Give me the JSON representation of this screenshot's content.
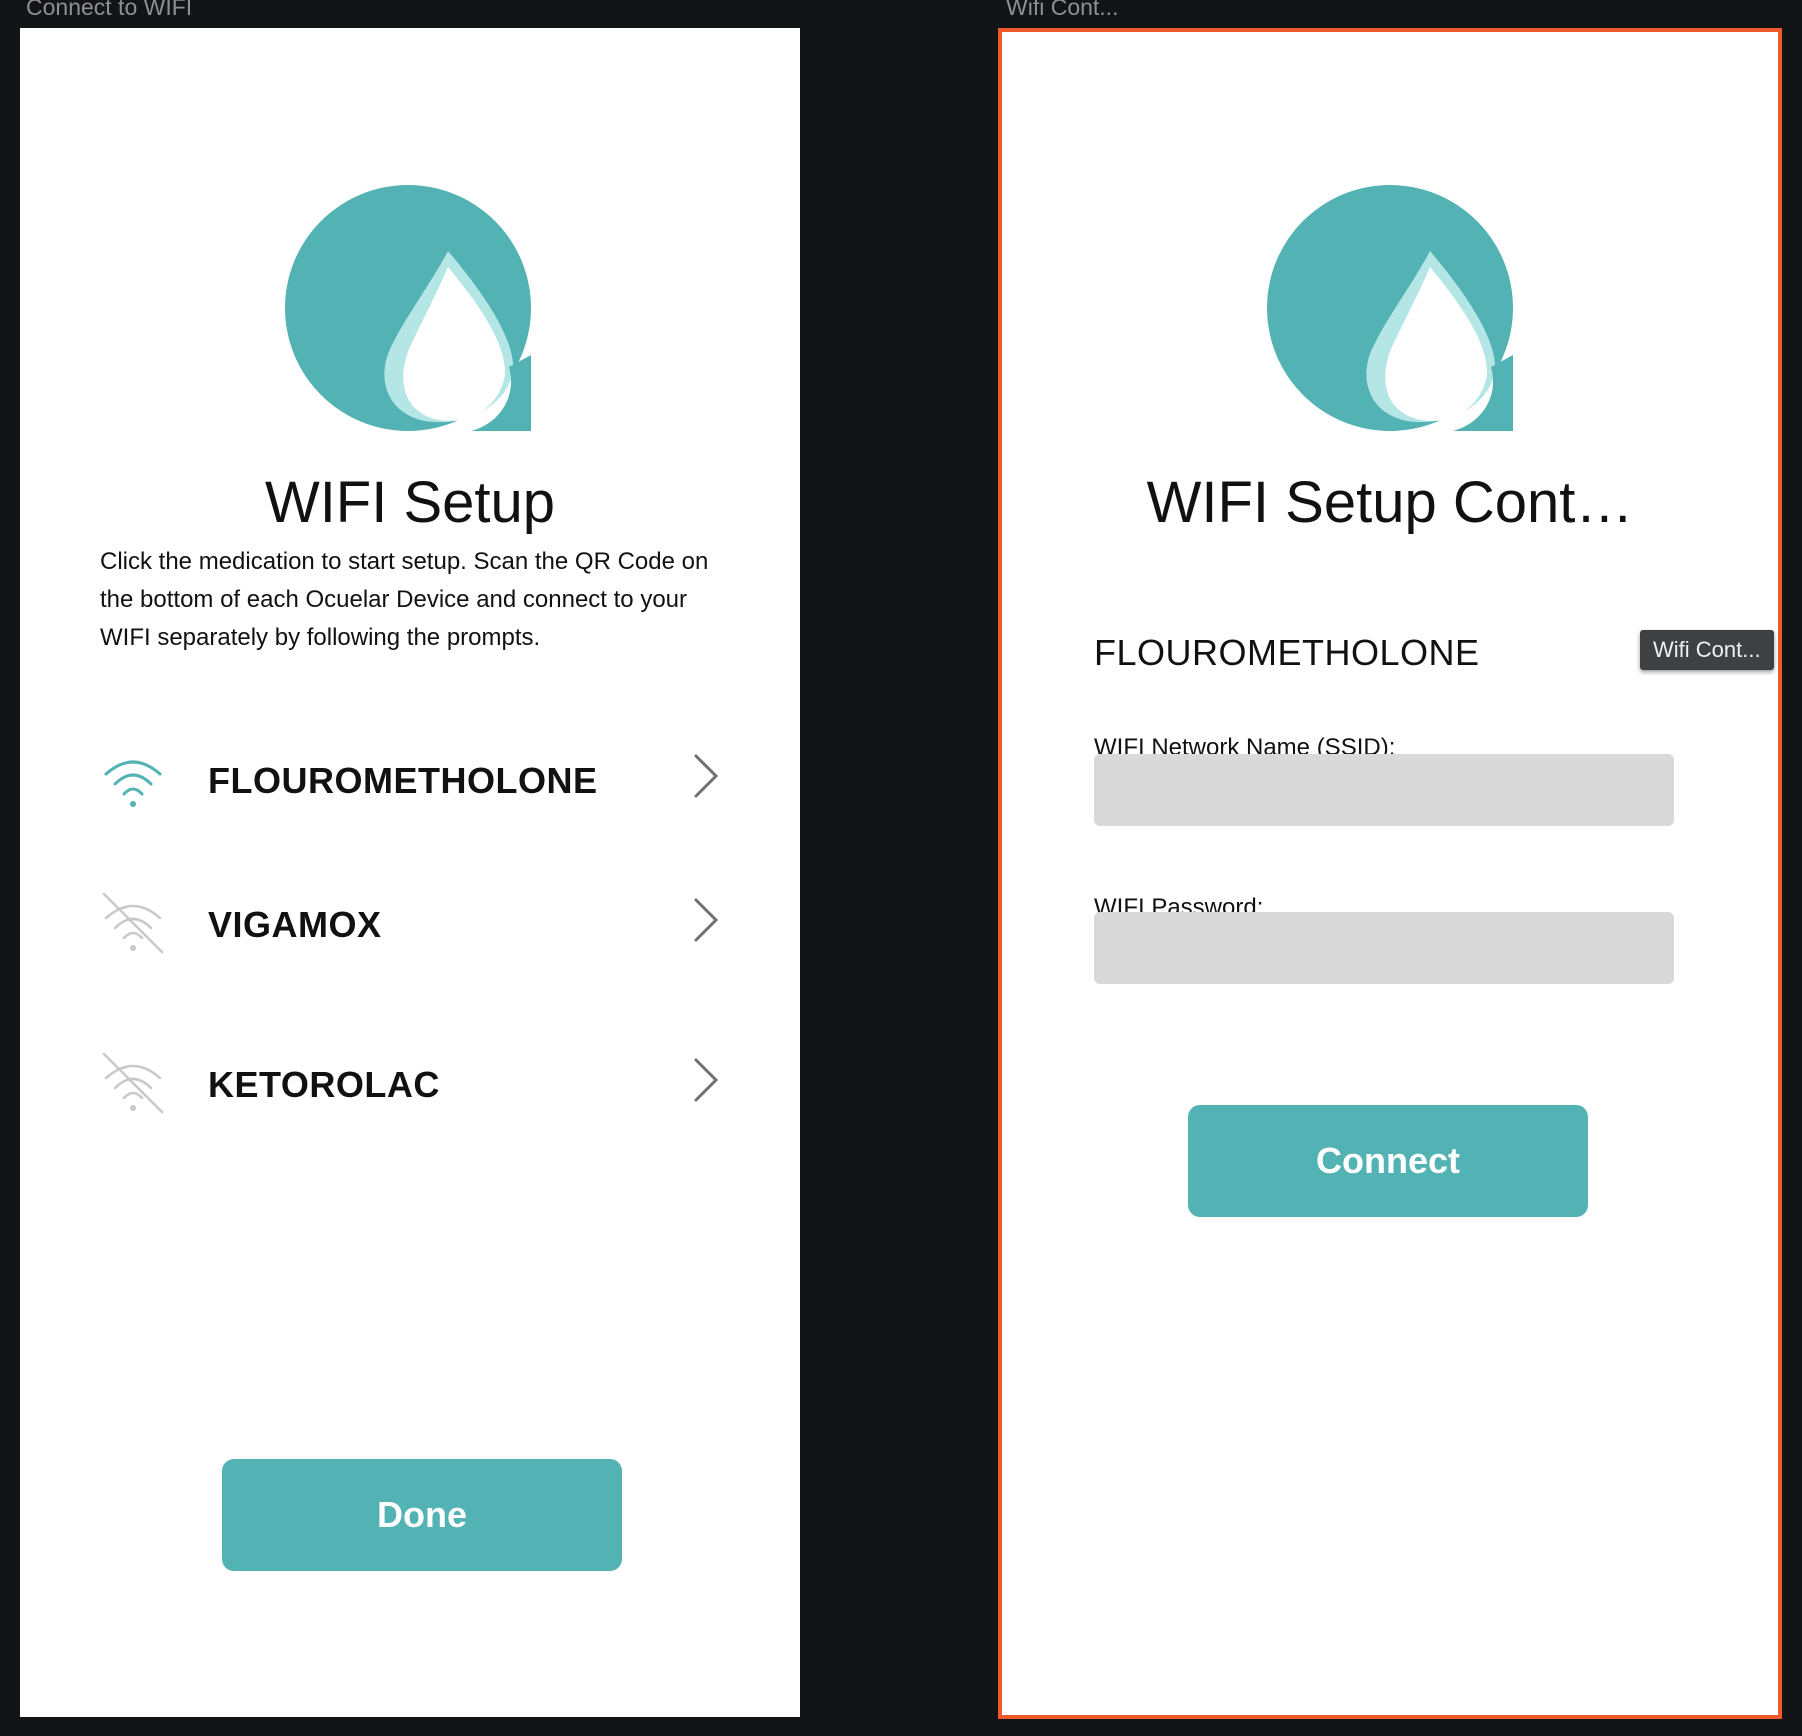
{
  "colors": {
    "teal": "#53b2b3",
    "teal_light": "#b5e6e6",
    "selection_border": "#ee5a2c",
    "canvas_bg": "#131416",
    "field_bg": "#d9d9d9"
  },
  "frames": {
    "left_label": "Connect to WIFI",
    "right_label": "Wifi Cont..."
  },
  "setup": {
    "title": "WIFI Setup",
    "description": "Click the medication to start setup. Scan the QR Code on the bottom of each Ocuelar Device and connect to your WIFI separately by following the prompts.",
    "medications": [
      {
        "name": "FLOUROMETHOLONE",
        "wifi_status": "connected",
        "icon": "wifi-icon"
      },
      {
        "name": "VIGAMOX",
        "wifi_status": "disconnected",
        "icon": "wifi-off-icon"
      },
      {
        "name": "KETOROLAC",
        "wifi_status": "disconnected",
        "icon": "wifi-off-icon"
      }
    ],
    "done_label": "Done"
  },
  "wifi_cont": {
    "title": "WIFI Setup Cont…",
    "medication": "FLOUROMETHOLONE",
    "ssid_label": "WIFI Network Name (SSID):",
    "ssid_value": "",
    "password_label": "WIFI Password:",
    "password_value": "",
    "connect_label": "Connect"
  },
  "tooltip": "Wifi Cont..."
}
